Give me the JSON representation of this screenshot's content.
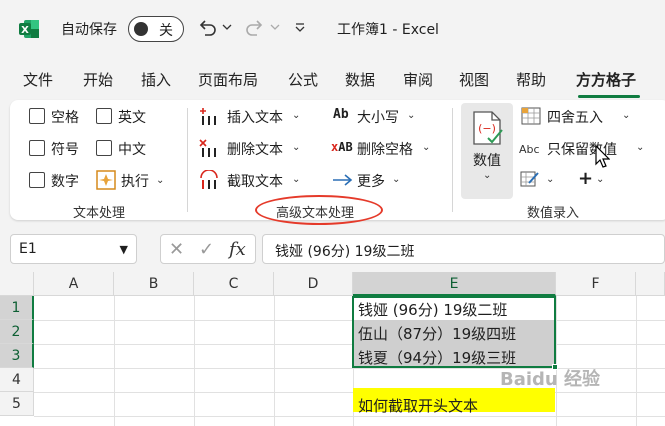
{
  "titlebar": {
    "autosave_label": "自动保存",
    "autosave_state": "关",
    "doc_title": "工作簿1  -  Excel"
  },
  "tabs": [
    "文件",
    "开始",
    "插入",
    "页面布局",
    "公式",
    "数据",
    "审阅",
    "视图",
    "帮助",
    "方方格子"
  ],
  "active_tab": "方方格子",
  "ribbon": {
    "text_group": {
      "items": [
        "空格",
        "英文",
        "符号",
        "中文",
        "数字",
        "执行"
      ],
      "label": "文本处理"
    },
    "adv_group": {
      "insert": "插入文本",
      "delete": "删除文本",
      "extract": "截取文本",
      "case": "大小写",
      "remove_space": "删除空格",
      "more": "更多",
      "label": "高级文本处理"
    },
    "num_group": {
      "value_btn": "数值",
      "round": "四舍五入",
      "keep_value": "只保留数值",
      "label": "数值录入"
    }
  },
  "formula_bar": {
    "name_box": "E1",
    "fx": "fx",
    "content": "钱娅 (96分) 19级二班"
  },
  "grid": {
    "columns": [
      "A",
      "B",
      "C",
      "D",
      "E",
      "F"
    ],
    "rows": [
      "1",
      "2",
      "3",
      "4",
      "5"
    ],
    "cells": {
      "E1": "钱娅 (96分) 19级二班",
      "E2": "伍山（87分）19级四班",
      "E3": "钱夏（94分）19级三班",
      "E5": "如何截取开头文本"
    }
  },
  "colors": {
    "accent": "#107c41",
    "highlight": "#ffff00",
    "annotation": "#e53a2a"
  },
  "watermark": "Baidu 经验"
}
